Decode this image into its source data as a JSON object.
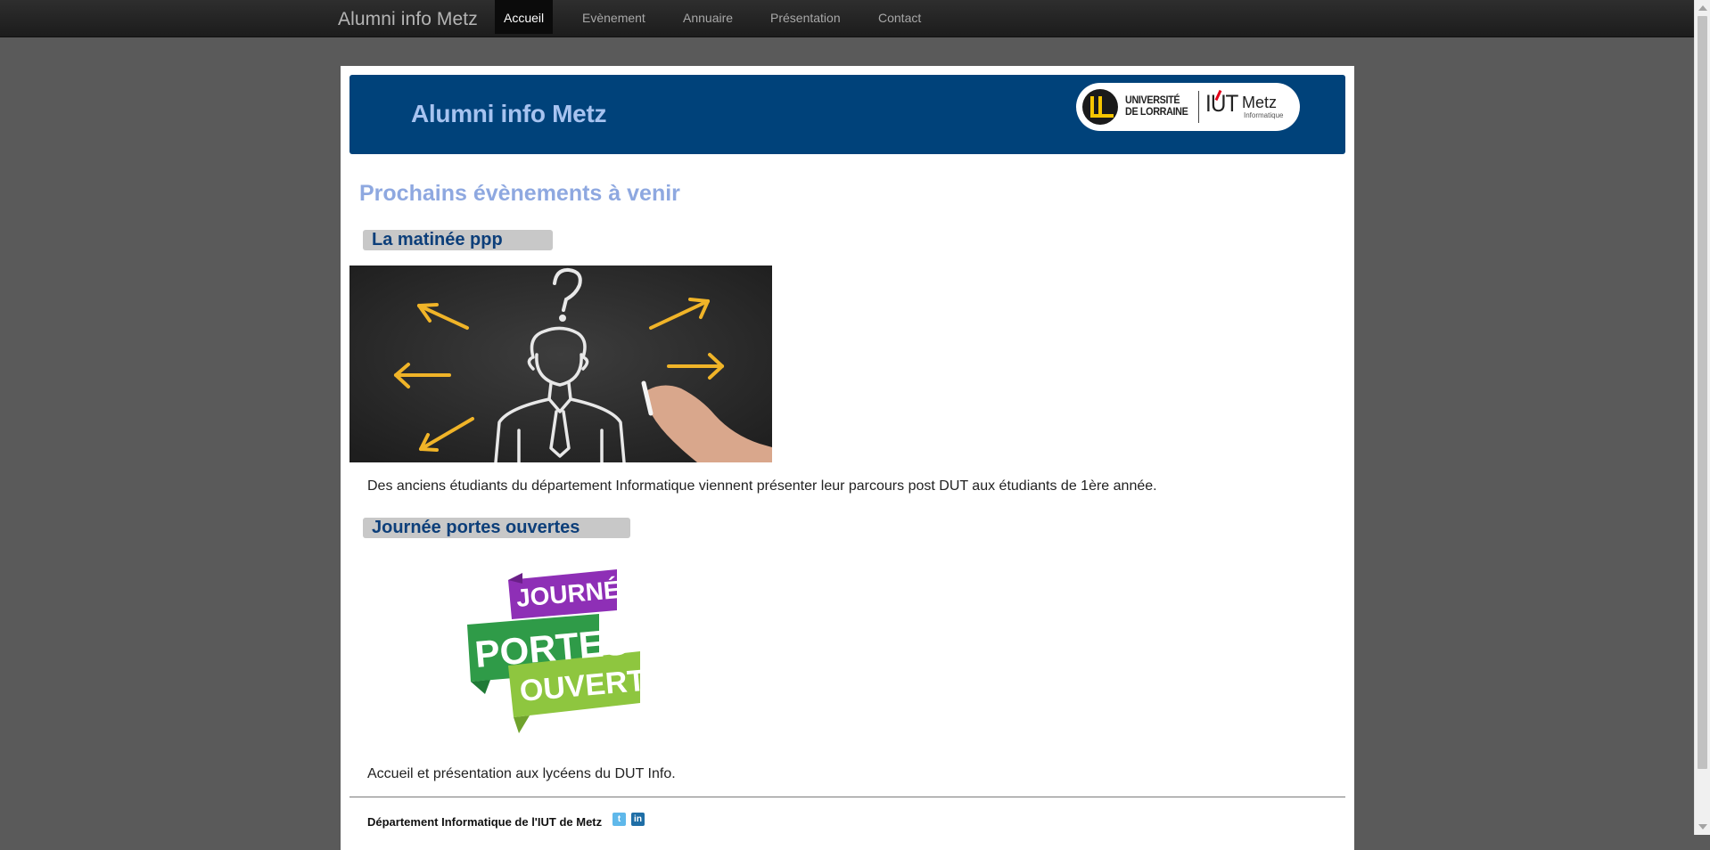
{
  "nav": {
    "brand": "Alumni info Metz",
    "items": [
      {
        "label": "Accueil",
        "active": true
      },
      {
        "label": "Evènement",
        "active": false
      },
      {
        "label": "Annuaire",
        "active": false
      },
      {
        "label": "Présentation",
        "active": false
      },
      {
        "label": "Contact",
        "active": false
      }
    ]
  },
  "banner": {
    "title": "Alumni info Metz",
    "logo": {
      "university_line1": "UNIVERSITÉ",
      "university_line2": "DE LORRAINE",
      "iut": "IUT",
      "city": "Metz",
      "department": "Informatique"
    }
  },
  "main": {
    "heading": "Prochains évènements à venir",
    "events": [
      {
        "title": "La matinée ppp",
        "image": "chalkboard-person-arrows",
        "description": "Des anciens étudiants du département Informatique viennent présenter leur parcours post DUT aux étudiants de 1ère année."
      },
      {
        "title": "Journée portes ouvertes",
        "image": "journees-portes-ouvertes-logo",
        "image_text": [
          "JOURNÉES",
          "PORTES",
          "OUVERTES"
        ],
        "description": "Accueil et présentation aux lycéens du DUT Info."
      }
    ]
  },
  "footer": {
    "text": "Département Informatique de l'IUT de Metz",
    "icons": [
      "twitter-icon",
      "linkedin-icon"
    ]
  },
  "colors": {
    "page_bg": "#5a5a5a",
    "navbar": "#1c1c1c",
    "banner": "#00427a",
    "banner_title": "#a7c3f0",
    "heading": "#8ea8e0",
    "event_title": "#0d3f7a",
    "event_title_bg": "#c8c8c8"
  }
}
